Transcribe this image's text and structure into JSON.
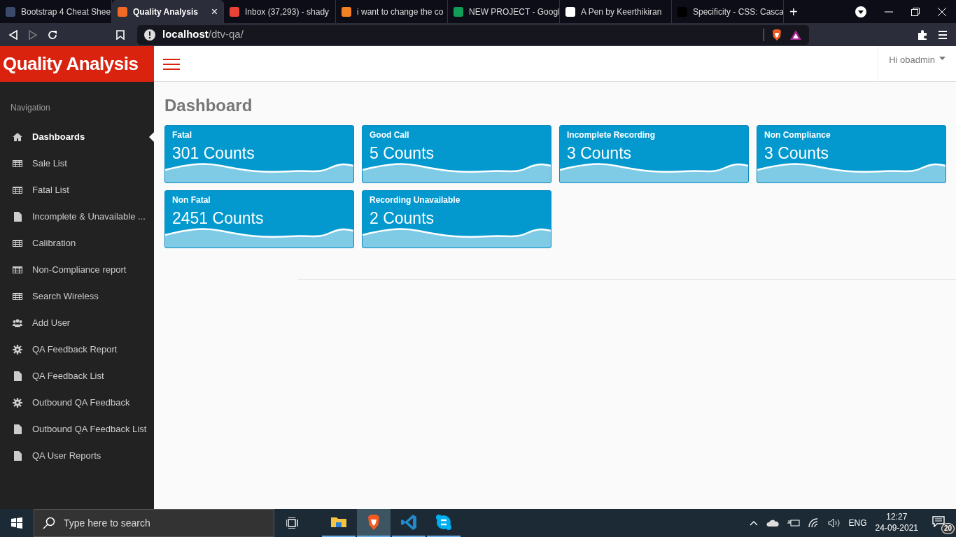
{
  "browser": {
    "tabs": [
      {
        "title": "Bootstrap 4 Cheat Shee",
        "color": "#3b4a6b",
        "selected": false
      },
      {
        "title": "Quality Analysis",
        "color": "#f06a23",
        "selected": true,
        "close": "×"
      },
      {
        "title": "Inbox (37,293) - shady",
        "color": "#ea4335",
        "selected": false
      },
      {
        "title": "i want to change the co",
        "color": "#f48024",
        "selected": false
      },
      {
        "title": "NEW PROJECT - Googl",
        "color": "#0f9d58",
        "selected": false
      },
      {
        "title": "A Pen by Keerthikiran",
        "color": "#ffffff",
        "selected": false
      },
      {
        "title": "Specificity - CSS: Casca",
        "color": "#000000",
        "selected": false
      }
    ],
    "new_tab": "+",
    "address": {
      "host": "localhost",
      "path": "/dtv-qa/"
    }
  },
  "app": {
    "brand": "Quality Analysis",
    "user": "Hi obadmin",
    "sidebar": {
      "heading": "Navigation",
      "items": [
        {
          "label": "Dashboards",
          "kind": "home",
          "selected": true
        },
        {
          "label": "Sale List",
          "kind": "table",
          "selected": false
        },
        {
          "label": "Fatal List",
          "kind": "table",
          "selected": false
        },
        {
          "label": "Incomplete & Unavailable ...",
          "kind": "file",
          "selected": false
        },
        {
          "label": "Calibration",
          "kind": "table",
          "selected": false
        },
        {
          "label": "Non-Compliance report",
          "kind": "table",
          "selected": false
        },
        {
          "label": "Search Wireless",
          "kind": "table",
          "selected": false
        },
        {
          "label": "Add User",
          "kind": "users",
          "selected": false
        },
        {
          "label": "QA Feedback Report",
          "kind": "gear",
          "selected": false
        },
        {
          "label": "QA Feedback List",
          "kind": "file",
          "selected": false
        },
        {
          "label": "Outbound QA Feedback",
          "kind": "gear",
          "selected": false
        },
        {
          "label": "Outbound QA Feedback List",
          "kind": "file",
          "selected": false
        },
        {
          "label": "QA User Reports",
          "kind": "file",
          "selected": false
        }
      ]
    },
    "page_title": "Dashboard",
    "cards": [
      {
        "title": "Fatal",
        "count": "301 Counts"
      },
      {
        "title": "Good Call",
        "count": "5 Counts"
      },
      {
        "title": "Incomplete Recording",
        "count": "3 Counts"
      },
      {
        "title": "Non Compliance",
        "count": "3 Counts"
      },
      {
        "title": "Non Fatal",
        "count": "2451 Counts"
      },
      {
        "title": "Recording Unavailable",
        "count": "2 Counts"
      }
    ]
  },
  "taskbar": {
    "search": {
      "placeholder": "Type here to search"
    },
    "apps": [
      {
        "kind": "folder",
        "selected": false
      },
      {
        "kind": "shield",
        "selected": true
      },
      {
        "kind": "code",
        "selected": false
      },
      {
        "kind": "chat",
        "selected": false
      }
    ],
    "language": "ENG",
    "time": "12:27",
    "date": "24-09-2021",
    "notifications": "20"
  }
}
